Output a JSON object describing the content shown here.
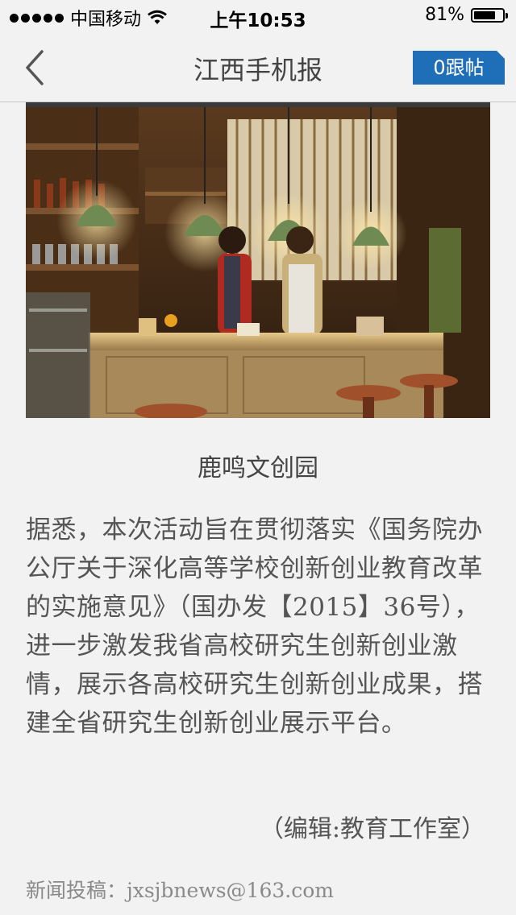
{
  "status_bar": {
    "carrier": "中国移动",
    "time": "上午10:53",
    "battery_percent_text": "81%",
    "battery_level": 0.81
  },
  "nav": {
    "title": "江西手机报",
    "comment_button": "0跟帖",
    "accent_color": "#1f6fb8"
  },
  "article": {
    "image_caption": "鹿鸣文创园",
    "body": "据悉，本次活动旨在贯彻落实《国务院办公厅关于深化高等学校创新创业教育改革的实施意见》（国办发【2015】36号），进一步激发我省高校研究生创新创业激情，展示各高校研究生创新创业成果，搭建全省研究生创新创业展示平台。",
    "editor": "（编辑:教育工作室）",
    "contact": "新闻投稿：jxsjbnews@163.com"
  }
}
